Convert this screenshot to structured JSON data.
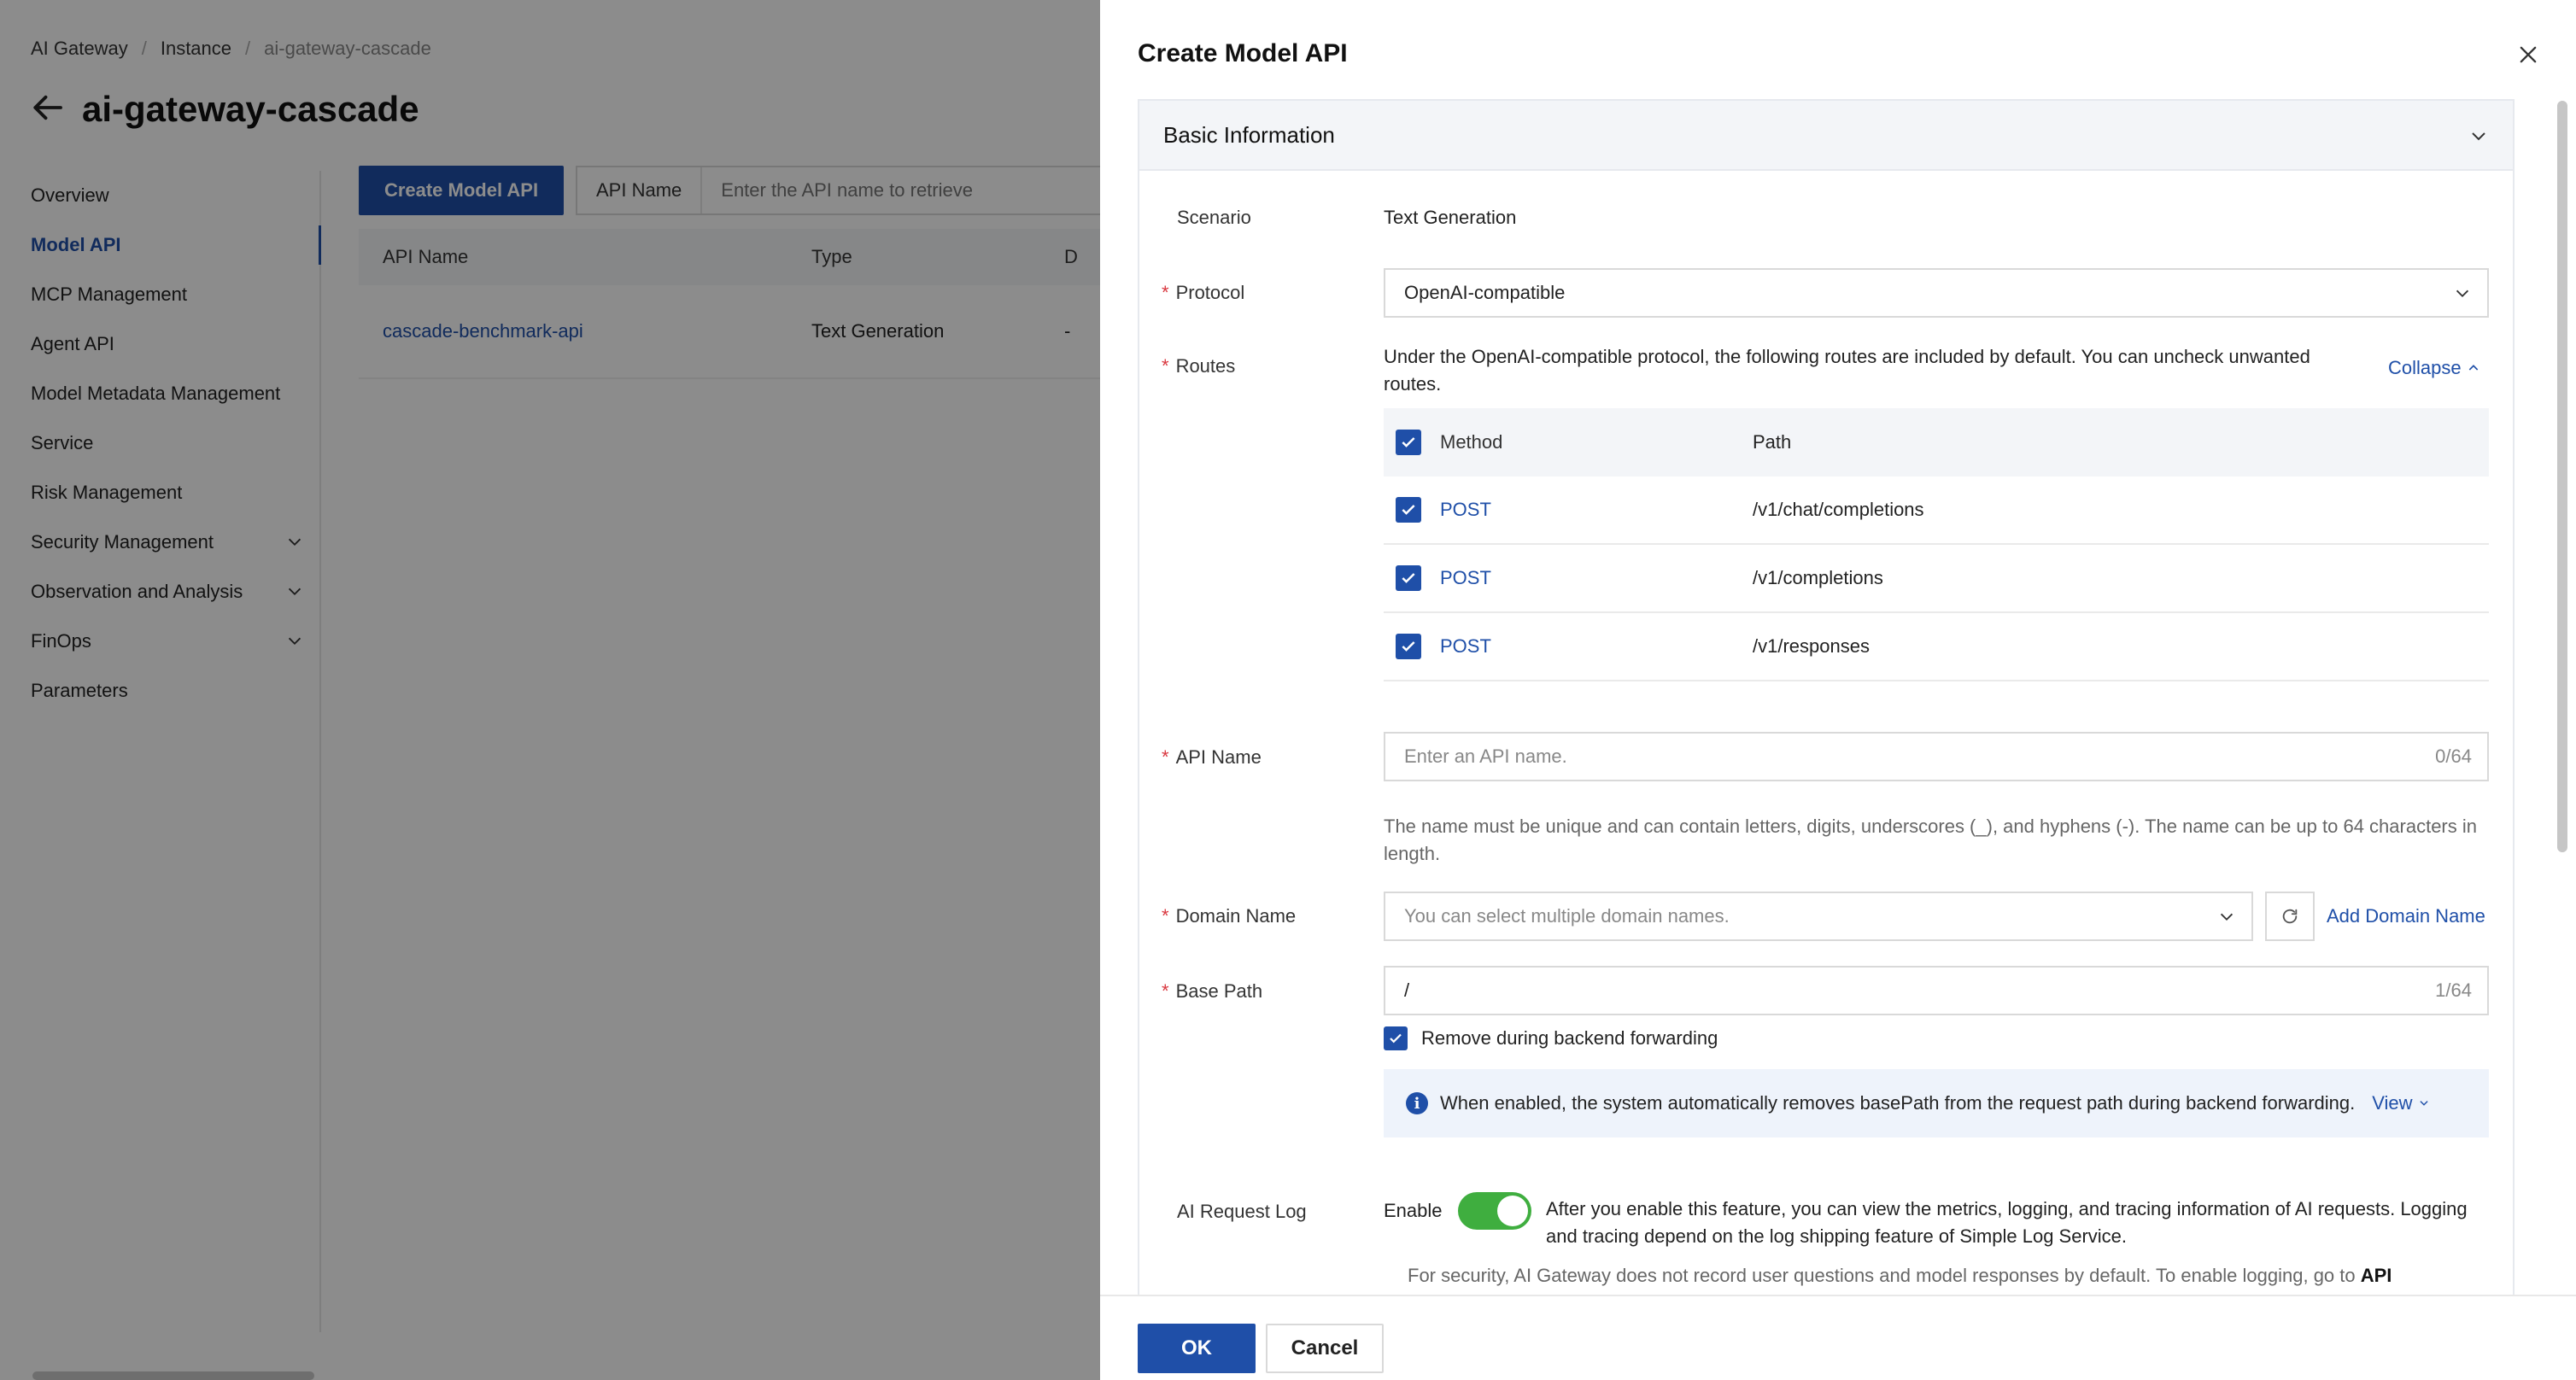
{
  "breadcrumb": [
    "AI Gateway",
    "Instance",
    "ai-gateway-cascade"
  ],
  "page_title": "ai-gateway-cascade",
  "sidebar": {
    "items": [
      {
        "label": "Overview"
      },
      {
        "label": "Model API",
        "active": true
      },
      {
        "label": "MCP Management"
      },
      {
        "label": "Agent API"
      },
      {
        "label": "Model Metadata Management"
      },
      {
        "label": "Service"
      },
      {
        "label": "Risk Management"
      },
      {
        "label": "Security Management",
        "expandable": true
      },
      {
        "label": "Observation and Analysis",
        "expandable": true
      },
      {
        "label": "FinOps",
        "expandable": true
      },
      {
        "label": "Parameters"
      }
    ]
  },
  "toolbar": {
    "create_label": "Create Model API",
    "search_label": "API Name",
    "search_placeholder": "Enter the API name to retrieve"
  },
  "bg_table": {
    "headers": [
      "API Name",
      "Type",
      "D"
    ],
    "rows": [
      [
        "cascade-benchmark-api",
        "Text Generation",
        "-"
      ]
    ]
  },
  "drawer": {
    "title": "Create Model API",
    "section_title": "Basic Information",
    "scenario_label": "Scenario",
    "scenario_value": "Text Generation",
    "protocol_label": "Protocol",
    "protocol_value": "OpenAI-compatible",
    "routes_label": "Routes",
    "routes_desc": "Under the OpenAI-compatible protocol, the following routes are included by default. You can uncheck unwanted routes.",
    "collapse_label": "Collapse",
    "routes_headers": {
      "method": "Method",
      "path": "Path"
    },
    "routes": [
      {
        "method": "POST",
        "path": "/v1/chat/completions"
      },
      {
        "method": "POST",
        "path": "/v1/completions"
      },
      {
        "method": "POST",
        "path": "/v1/responses"
      }
    ],
    "api_name_label": "API Name",
    "api_name_placeholder": "Enter an API name.",
    "api_name_counter": "0/64",
    "api_name_hint": "The name must be unique and can contain letters, digits, underscores (_), and hyphens (-). The name can be up to 64 characters in length.",
    "domain_label": "Domain Name",
    "domain_placeholder": "You can select multiple domain names.",
    "add_domain_label": "Add Domain Name",
    "base_path_label": "Base Path",
    "base_path_value": "/",
    "base_path_counter": "1/64",
    "remove_label": "Remove during backend forwarding",
    "info_text": "When enabled, the system automatically removes basePath from the request path during backend forwarding.",
    "view_label": "View",
    "ai_log_label": "AI Request Log",
    "enable_label": "Enable",
    "ai_log_enabled": true,
    "ai_log_desc": "After you enable this feature, you can view the metrics, logging, and tracing information of AI requests. Logging and tracing depend on the log shipping feature of Simple Log Service.",
    "security_note": "For security, AI Gateway does not record user questions and model responses by default. To enable logging, go to",
    "security_note_link": "API",
    "ok_label": "OK",
    "cancel_label": "Cancel"
  },
  "colors": {
    "primary": "#1f4fa8",
    "toggle_on": "#3fae3f",
    "required": "#d9363e"
  }
}
